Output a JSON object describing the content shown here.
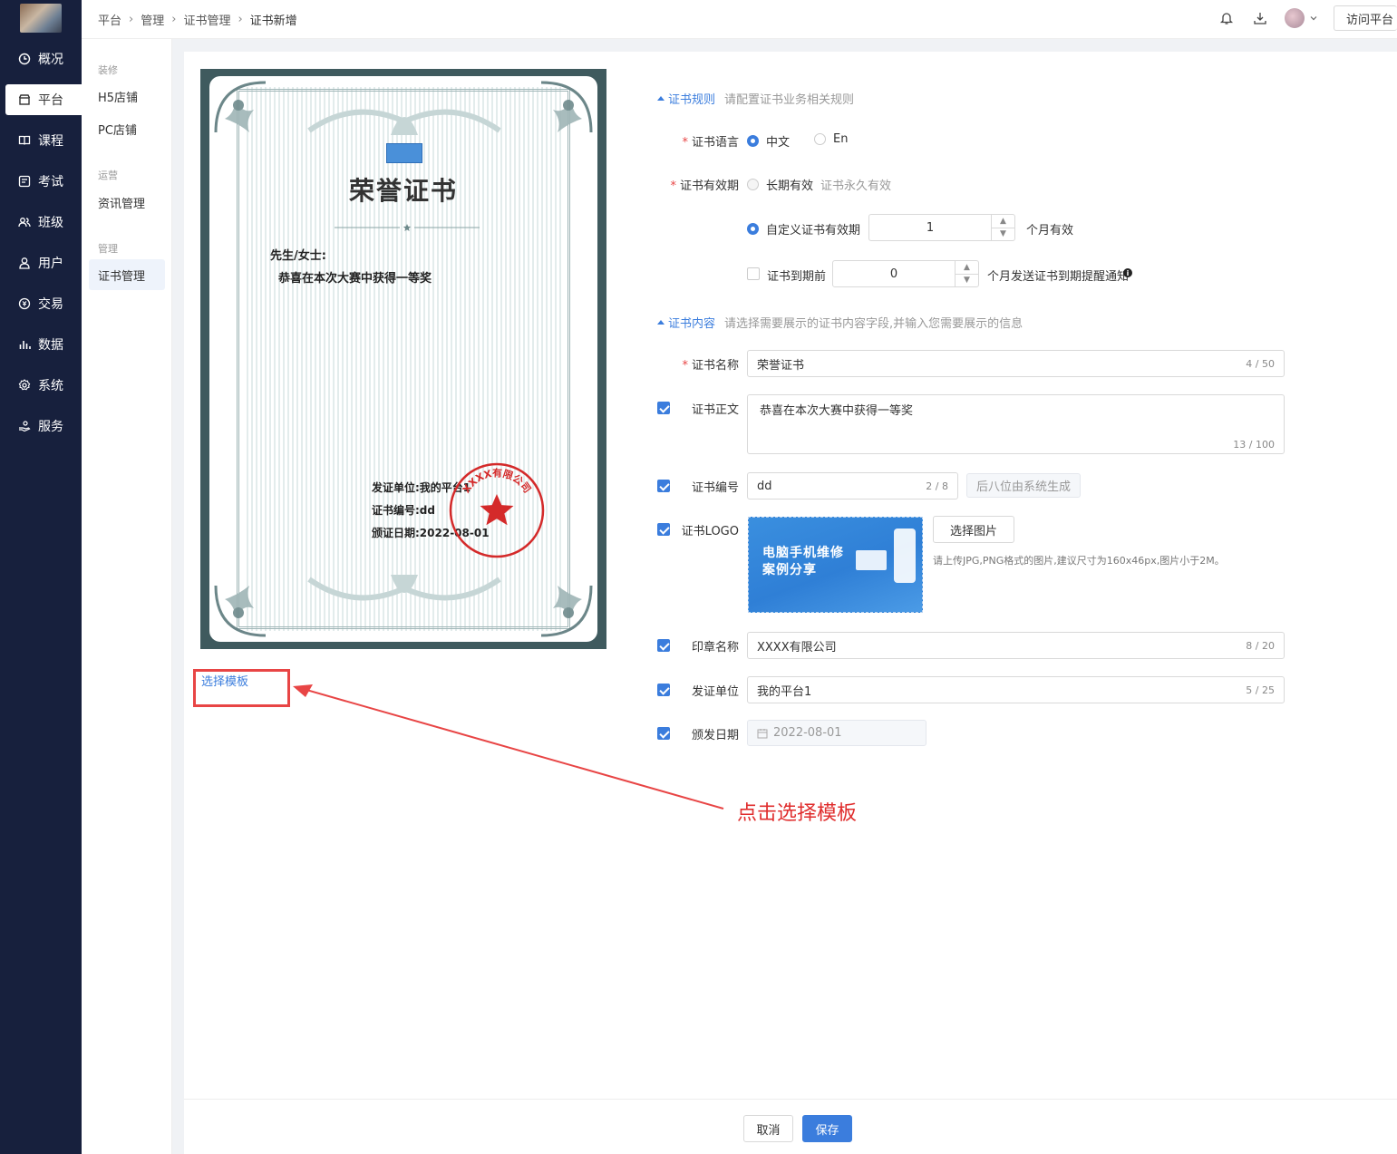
{
  "nav": {
    "items": [
      {
        "label": "概况",
        "icon": "clock-icon"
      },
      {
        "label": "平台",
        "icon": "store-icon"
      },
      {
        "label": "课程",
        "icon": "book-icon"
      },
      {
        "label": "考试",
        "icon": "exam-icon"
      },
      {
        "label": "班级",
        "icon": "group-icon"
      },
      {
        "label": "用户",
        "icon": "user-icon"
      },
      {
        "label": "交易",
        "icon": "transaction-icon"
      },
      {
        "label": "数据",
        "icon": "chart-icon"
      },
      {
        "label": "系统",
        "icon": "gear-icon"
      },
      {
        "label": "服务",
        "icon": "service-icon"
      }
    ],
    "active": "平台"
  },
  "subnav": {
    "groups": [
      {
        "title": "装修",
        "items": [
          "H5店铺",
          "PC店铺"
        ]
      },
      {
        "title": "运营",
        "items": [
          "资讯管理"
        ]
      },
      {
        "title": "管理",
        "items": [
          "证书管理"
        ]
      }
    ],
    "active": "证书管理"
  },
  "breadcrumb": [
    "平台",
    "管理",
    "证书管理",
    "证书新增"
  ],
  "topbar": {
    "visit_label": "访问平台"
  },
  "certificate": {
    "title": "荣誉证书",
    "greeting": "先生/女士:",
    "body": "恭喜在本次大赛中获得一等奖",
    "issuer_line": "发证单位:我的平台1",
    "number_line": "证书编号:dd",
    "date_line": "颁证日期:2022-08-01",
    "seal_text": "XXXX有限公司",
    "seal_color": "#d42a2a"
  },
  "choose_template": "选择模板",
  "annotation": "点击选择模板",
  "rules": {
    "section_title": "证书规则",
    "section_hint": "请配置证书业务相关规则",
    "language_label": "证书语言",
    "language_options": [
      "中文",
      "En"
    ],
    "language_selected": "中文",
    "validity_label": "证书有效期",
    "validity_permanent": "长期有效",
    "validity_permanent_hint": "证书永久有效",
    "validity_custom": "自定义证书有效期",
    "validity_months": "1",
    "validity_unit": "个月有效",
    "expiry_label": "证书到期前",
    "expiry_months": "0",
    "expiry_unit": "个月发送证书到期提醒通知"
  },
  "content": {
    "section_title": "证书内容",
    "section_hint": "请选择需要展示的证书内容字段,并输入您需要展示的信息",
    "name_label": "证书名称",
    "name_value": "荣誉证书",
    "name_count": "4 / 50",
    "body_label": "证书正文",
    "body_value": "恭喜在本次大赛中获得一等奖",
    "body_count": "13 / 100",
    "number_label": "证书编号",
    "number_value": "dd",
    "number_count": "2 / 8",
    "number_suffix": "后八位由系统生成",
    "logo_label": "证书LOGO",
    "logo_text_line1": "电脑手机维修",
    "logo_text_line2": "案例分享",
    "logo_button": "选择图片",
    "logo_hint": "请上传JPG,PNG格式的图片,建议尺寸为160x46px,图片小于2M。",
    "seal_label": "印章名称",
    "seal_value": "XXXX有限公司",
    "seal_count": "8 / 20",
    "issuer_label": "发证单位",
    "issuer_value": "我的平台1",
    "issuer_count": "5 / 25",
    "date_label": "颁发日期",
    "date_value": "2022-08-01"
  },
  "footer": {
    "cancel": "取消",
    "save": "保存"
  },
  "colors": {
    "accent": "#3b7ddd",
    "nav_bg": "#17203d",
    "annotation": "#e02e2e"
  }
}
